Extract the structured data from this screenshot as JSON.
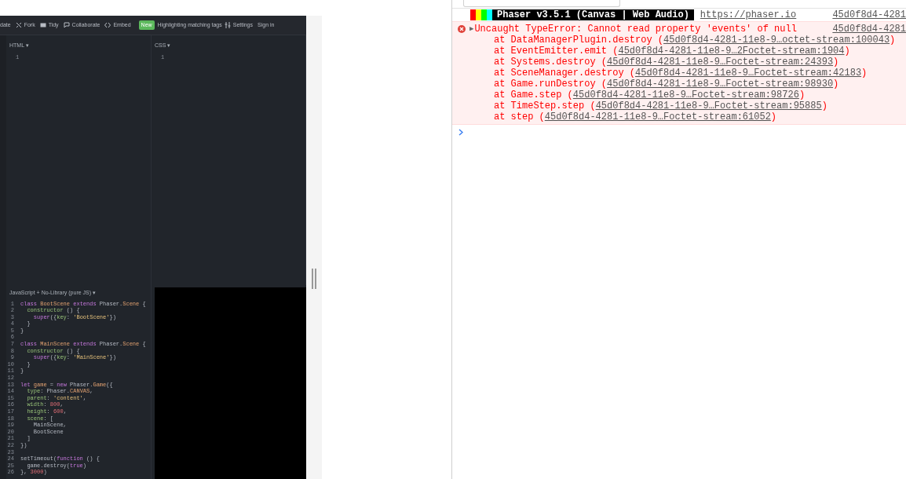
{
  "editor": {
    "toolbar": {
      "update": "date",
      "fork": "Fork",
      "tidy": "Tidy",
      "collaborate": "Collaborate",
      "embed": "Embed",
      "new_badge": "New",
      "highlighting": "Highlighting matching tags",
      "settings": "Settings",
      "sign_in": "Sign in"
    },
    "html_panel": {
      "label": "HTML ▾",
      "line_number": "1"
    },
    "css_panel": {
      "label": "CSS ▾",
      "line_number": "1"
    },
    "js_panel": {
      "label": "JavaScript + No-Library (pure JS) ▾",
      "lines": [
        {
          "number": "1",
          "tokens": [
            {
              "text": "class",
              "kind": "kw"
            },
            {
              "text": " BootScene",
              "kind": "def"
            },
            {
              "text": " extends",
              "kind": "kw"
            },
            {
              "text": " Phaser.",
              "kind": "plain"
            },
            {
              "text": "Scene",
              "kind": "def"
            },
            {
              "text": " {",
              "kind": "plain"
            }
          ]
        },
        {
          "number": "2",
          "tokens": [
            {
              "text": "  constructor",
              "kind": "prop"
            },
            {
              "text": " () {",
              "kind": "plain"
            }
          ]
        },
        {
          "number": "3",
          "tokens": [
            {
              "text": "    super",
              "kind": "kw"
            },
            {
              "text": "({",
              "kind": "plain"
            },
            {
              "text": "key",
              "kind": "prop"
            },
            {
              "text": ": ",
              "kind": "plain"
            },
            {
              "text": "'BootScene'",
              "kind": "str"
            },
            {
              "text": "})",
              "kind": "plain"
            }
          ]
        },
        {
          "number": "4",
          "tokens": [
            {
              "text": "  }",
              "kind": "plain"
            }
          ]
        },
        {
          "number": "5",
          "tokens": [
            {
              "text": "}",
              "kind": "plain"
            }
          ]
        },
        {
          "number": "6"
        },
        {
          "number": "7",
          "tokens": [
            {
              "text": "class",
              "kind": "kw"
            },
            {
              "text": " MainScene",
              "kind": "def"
            },
            {
              "text": " extends",
              "kind": "kw"
            },
            {
              "text": " Phaser.",
              "kind": "plain"
            },
            {
              "text": "Scene",
              "kind": "def"
            },
            {
              "text": " {",
              "kind": "plain"
            }
          ]
        },
        {
          "number": "8",
          "tokens": [
            {
              "text": "  constructor",
              "kind": "prop"
            },
            {
              "text": " () {",
              "kind": "plain"
            }
          ]
        },
        {
          "number": "9",
          "tokens": [
            {
              "text": "    super",
              "kind": "kw"
            },
            {
              "text": "({",
              "kind": "plain"
            },
            {
              "text": "key",
              "kind": "prop"
            },
            {
              "text": ": ",
              "kind": "plain"
            },
            {
              "text": "'MainScene'",
              "kind": "str"
            },
            {
              "text": "})",
              "kind": "plain"
            }
          ]
        },
        {
          "number": "10",
          "tokens": [
            {
              "text": "  }",
              "kind": "plain"
            }
          ]
        },
        {
          "number": "11",
          "tokens": [
            {
              "text": "}",
              "kind": "plain"
            }
          ]
        },
        {
          "number": "12"
        },
        {
          "number": "13",
          "tokens": [
            {
              "text": "let",
              "kind": "kw"
            },
            {
              "text": " game",
              "kind": "def"
            },
            {
              "text": " = ",
              "kind": "plain"
            },
            {
              "text": "new",
              "kind": "kw"
            },
            {
              "text": " Phaser.",
              "kind": "plain"
            },
            {
              "text": "Game",
              "kind": "def"
            },
            {
              "text": "({",
              "kind": "plain"
            }
          ]
        },
        {
          "number": "14",
          "tokens": [
            {
              "text": "  type",
              "kind": "prop"
            },
            {
              "text": ": Phaser.",
              "kind": "plain"
            },
            {
              "text": "CANVAS",
              "kind": "def"
            },
            {
              "text": ",",
              "kind": "plain"
            }
          ]
        },
        {
          "number": "15",
          "tokens": [
            {
              "text": "  parent",
              "kind": "prop"
            },
            {
              "text": ": ",
              "kind": "plain"
            },
            {
              "text": "'content'",
              "kind": "str"
            },
            {
              "text": ",",
              "kind": "plain"
            }
          ]
        },
        {
          "number": "16",
          "tokens": [
            {
              "text": "  width",
              "kind": "prop"
            },
            {
              "text": ": ",
              "kind": "plain"
            },
            {
              "text": "800",
              "kind": "num"
            },
            {
              "text": ",",
              "kind": "plain"
            }
          ]
        },
        {
          "number": "17",
          "tokens": [
            {
              "text": "  height",
              "kind": "prop"
            },
            {
              "text": ": ",
              "kind": "plain"
            },
            {
              "text": "600",
              "kind": "num"
            },
            {
              "text": ",",
              "kind": "plain"
            }
          ]
        },
        {
          "number": "18",
          "tokens": [
            {
              "text": "  scene",
              "kind": "prop"
            },
            {
              "text": ": [",
              "kind": "plain"
            }
          ]
        },
        {
          "number": "19",
          "tokens": [
            {
              "text": "    MainScene,",
              "kind": "plain"
            }
          ]
        },
        {
          "number": "20",
          "tokens": [
            {
              "text": "    BootScene",
              "kind": "plain"
            }
          ]
        },
        {
          "number": "21",
          "tokens": [
            {
              "text": "  ]",
              "kind": "plain"
            }
          ]
        },
        {
          "number": "22",
          "tokens": [
            {
              "text": "})",
              "kind": "plain"
            }
          ]
        },
        {
          "number": "23"
        },
        {
          "number": "24",
          "tokens": [
            {
              "text": "setTimeout(",
              "kind": "plain"
            },
            {
              "text": "function",
              "kind": "kw"
            },
            {
              "text": " () {",
              "kind": "plain"
            }
          ]
        },
        {
          "number": "25",
          "tokens": [
            {
              "text": "  game.destroy(",
              "kind": "plain"
            },
            {
              "text": "true",
              "kind": "kw"
            },
            {
              "text": ")",
              "kind": "plain"
            }
          ]
        },
        {
          "number": "26",
          "tokens": [
            {
              "text": "}, ",
              "kind": "plain"
            },
            {
              "text": "3000",
              "kind": "num"
            },
            {
              "text": ")",
              "kind": "plain"
            }
          ]
        }
      ]
    }
  },
  "console": {
    "banner": {
      "stripes": [
        {
          "color": "#ff0000"
        },
        {
          "color": "#ffff00"
        },
        {
          "color": "#00ff00"
        },
        {
          "color": "#00ffff"
        }
      ],
      "text": "Phaser v3.5.1 (Canvas | Web Audio)",
      "link": "https://phaser.io",
      "source": "45d0f8d4-4281"
    },
    "error": {
      "toggle": "▶",
      "message": "Uncaught TypeError: Cannot read property 'events' of null",
      "source": "45d0f8d4-4281",
      "stack": [
        {
          "prefix": "at DataManagerPlugin.destroy (",
          "location": "45d0f8d4-4281-11e8-9…octet-stream:100043",
          "suffix": ")"
        },
        {
          "prefix": "at EventEmitter.emit (",
          "location": "45d0f8d4-4281-11e8-9…2Foctet-stream:1904",
          "suffix": ")"
        },
        {
          "prefix": "at Systems.destroy (",
          "location": "45d0f8d4-4281-11e8-9…Foctet-stream:24393",
          "suffix": ")"
        },
        {
          "prefix": "at SceneManager.destroy (",
          "location": "45d0f8d4-4281-11e8-9…Foctet-stream:42183",
          "suffix": ")"
        },
        {
          "prefix": "at Game.runDestroy (",
          "location": "45d0f8d4-4281-11e8-9…Foctet-stream:98930",
          "suffix": ")"
        },
        {
          "prefix": "at Game.step (",
          "location": "45d0f8d4-4281-11e8-9…Foctet-stream:98726",
          "suffix": ")"
        },
        {
          "prefix": "at TimeStep.step (",
          "location": "45d0f8d4-4281-11e8-9…Foctet-stream:95885",
          "suffix": ")"
        },
        {
          "prefix": "at step (",
          "location": "45d0f8d4-4281-11e8-9…Foctet-stream:61052",
          "suffix": ")"
        }
      ]
    }
  }
}
